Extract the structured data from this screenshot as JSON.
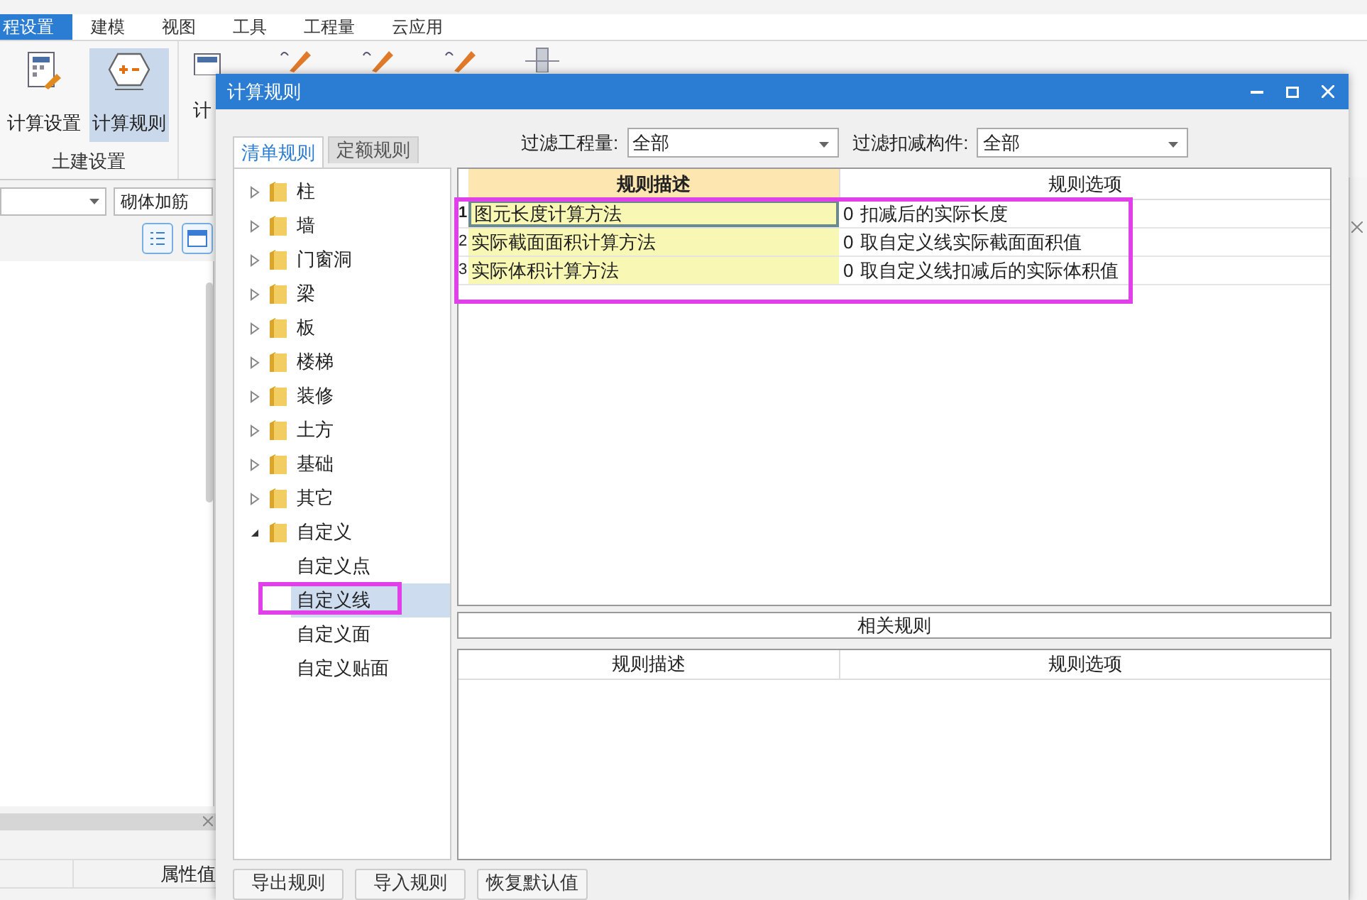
{
  "app": {
    "menu": [
      {
        "label": "程设置",
        "selected": true
      },
      {
        "label": "建模",
        "selected": false
      },
      {
        "label": "视图",
        "selected": false
      },
      {
        "label": "工具",
        "selected": false
      },
      {
        "label": "工程量",
        "selected": false
      },
      {
        "label": "云应用",
        "selected": false
      }
    ],
    "ribbon": {
      "buttons": [
        {
          "label": "计算设置",
          "kind": "settings",
          "selected": false
        },
        {
          "label": "计算规则",
          "kind": "rules",
          "selected": true
        },
        {
          "label": "计",
          "kind": "table",
          "selected": false
        }
      ],
      "group_label": "土建设置"
    },
    "left_panel": {
      "field_value": "砌体加筋",
      "property_header": "属性值"
    }
  },
  "dialog": {
    "title": "计算规则",
    "tabs": [
      {
        "label": "清单规则",
        "selected": true
      },
      {
        "label": "定额规则",
        "selected": false
      }
    ],
    "filters": [
      {
        "label": "过滤工程量:",
        "value": "全部"
      },
      {
        "label": "过滤扣减构件:",
        "value": "全部"
      }
    ],
    "tree": [
      {
        "label": "柱",
        "expanded": false
      },
      {
        "label": "墙",
        "expanded": false
      },
      {
        "label": "门窗洞",
        "expanded": false
      },
      {
        "label": "梁",
        "expanded": false
      },
      {
        "label": "板",
        "expanded": false
      },
      {
        "label": "楼梯",
        "expanded": false
      },
      {
        "label": "装修",
        "expanded": false
      },
      {
        "label": "土方",
        "expanded": false
      },
      {
        "label": "基础",
        "expanded": false
      },
      {
        "label": "其它",
        "expanded": false
      },
      {
        "label": "自定义",
        "expanded": true,
        "children": [
          {
            "label": "自定义点",
            "selected": false,
            "highlighted": false
          },
          {
            "label": "自定义线",
            "selected": true,
            "highlighted": true
          },
          {
            "label": "自定义面",
            "selected": false,
            "highlighted": false
          },
          {
            "label": "自定义贴面",
            "selected": false,
            "highlighted": false
          }
        ]
      }
    ],
    "rules_table": {
      "columns": [
        "规则描述",
        "规则选项"
      ],
      "highlighted": true,
      "rows": [
        {
          "number": "1",
          "description": "图元长度计算方法",
          "option_code": "0",
          "option": "扣减后的实际长度",
          "selected": true
        },
        {
          "number": "2",
          "description": "实际截面面积计算方法",
          "option_code": "0",
          "option": "取自定义线实际截面面积值",
          "selected": false
        },
        {
          "number": "3",
          "description": "实际体积计算方法",
          "option_code": "0",
          "option": "取自定义线扣减后的实际体积值",
          "selected": false
        }
      ]
    },
    "related_rules": {
      "title": "相关规则",
      "columns": [
        "规则描述",
        "规则选项"
      ]
    },
    "buttons": [
      "导出规则",
      "导入规则",
      "恢复默认值"
    ]
  }
}
